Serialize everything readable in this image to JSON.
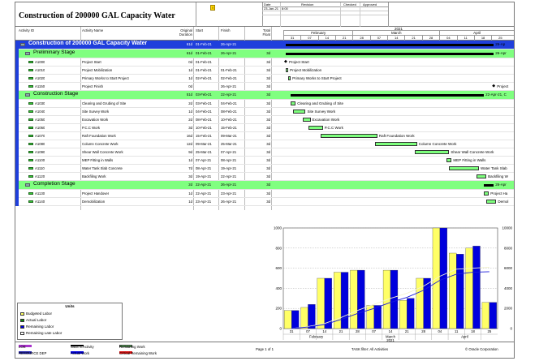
{
  "header": {
    "title": "Construction of 200000 GAL Capacity Water",
    "rev_headers": [
      "Date",
      "Revision",
      "Checked",
      "Approved"
    ],
    "rev_row": [
      "23-Jan-21",
      "8:00"
    ]
  },
  "columns": {
    "activity_id": "Activity ID",
    "activity_name": "Activity Name",
    "orig_duration": "Original Duration",
    "start": "Start",
    "finish": "Finish",
    "total_float": "Total Float"
  },
  "timeline": {
    "year": "2021",
    "months": [
      "February",
      "March",
      "April"
    ],
    "days": [
      "31",
      "07",
      "14",
      "21",
      "28",
      "07",
      "14",
      "21",
      "28",
      "04",
      "11",
      "18",
      "25"
    ]
  },
  "rows": [
    {
      "type": "wbs1",
      "id": "",
      "name": "Construction of 200000 GAL Capacity Water",
      "dur": "61d",
      "start": "01-Feb-21",
      "finish": "26-Apr-21",
      "float": ""
    },
    {
      "type": "wbs2",
      "id": "",
      "name": "Preliminary Stage",
      "dur": "61d",
      "start": "01-Feb-21",
      "finish": "26-Apr-21",
      "float": "3d"
    },
    {
      "type": "task",
      "id": "A1000",
      "name": "Project Start",
      "dur": "0d",
      "start": "01-Feb-21",
      "finish": "",
      "float": "3d"
    },
    {
      "type": "task",
      "id": "A1010",
      "name": "Project Mobilization",
      "dur": "1d",
      "start": "01-Feb-21",
      "finish": "01-Feb-21",
      "float": "3d"
    },
    {
      "type": "task",
      "id": "A1020",
      "name": "Primary Works to Start Project",
      "dur": "1d",
      "start": "02-Feb-21",
      "finish": "02-Feb-21",
      "float": "3d"
    },
    {
      "type": "task",
      "id": "A1150",
      "name": "Project Finish",
      "dur": "0d",
      "start": "",
      "finish": "26-Apr-21",
      "float": "3d"
    },
    {
      "type": "wbs2",
      "id": "",
      "name": "Construction Stage",
      "dur": "51d",
      "start": "03-Feb-21",
      "finish": "22-Apr-21",
      "float": "3d"
    },
    {
      "type": "task",
      "id": "A1030",
      "name": "Clearing and Grubing of Site",
      "dur": "2d",
      "start": "03-Feb-21",
      "finish": "04-Feb-21",
      "float": "3d"
    },
    {
      "type": "task",
      "id": "A1040",
      "name": "Site Survey Work",
      "dur": "1d",
      "start": "04-Feb-21",
      "finish": "08-Feb-21",
      "float": "3d"
    },
    {
      "type": "task",
      "id": "A1050",
      "name": "Excavation Work",
      "dur": "2d",
      "start": "08-Feb-21",
      "finish": "10-Feb-21",
      "float": "3d"
    },
    {
      "type": "task",
      "id": "A1060",
      "name": "P.C.C Work",
      "dur": "3d",
      "start": "10-Feb-21",
      "finish": "15-Feb-21",
      "float": "3d"
    },
    {
      "type": "task",
      "id": "A1070",
      "name": "Raft Foundation Work",
      "dur": "16d",
      "start": "15-Feb-21",
      "finish": "09-Mar-21",
      "float": "3d"
    },
    {
      "type": "task",
      "id": "A1080",
      "name": "Column Concrete Work",
      "dur": "12d",
      "start": "09-Mar-21",
      "finish": "25-Mar-21",
      "float": "3d"
    },
    {
      "type": "task",
      "id": "A1090",
      "name": "Shear Wall Concrete Work",
      "dur": "9d",
      "start": "25-Mar-21",
      "finish": "07-Apr-21",
      "float": "3d"
    },
    {
      "type": "task",
      "id": "A1100",
      "name": "MEP Fitting in Walls",
      "dur": "1d",
      "start": "07-Apr-21",
      "finish": "08-Apr-21",
      "float": "3d"
    },
    {
      "type": "task",
      "id": "A1110",
      "name": "Water Tank Slab Concrete",
      "dur": "7d",
      "start": "08-Apr-21",
      "finish": "19-Apr-21",
      "float": "3d"
    },
    {
      "type": "task",
      "id": "A1120",
      "name": "Backfiling Work",
      "dur": "3d",
      "start": "19-Apr-21",
      "finish": "22-Apr-21",
      "float": "3d"
    },
    {
      "type": "wbs2",
      "id": "",
      "name": "Completion Stage",
      "dur": "2d",
      "start": "22-Apr-21",
      "finish": "26-Apr-21",
      "float": "3d"
    },
    {
      "type": "task",
      "id": "A1130",
      "name": "Project Handover",
      "dur": "1d",
      "start": "22-Apr-21",
      "finish": "23-Apr-21",
      "float": "3d"
    },
    {
      "type": "task",
      "id": "A1140",
      "name": "Demobilization",
      "dur": "1d",
      "start": "23-Apr-21",
      "finish": "26-Apr-21",
      "float": "3d"
    }
  ],
  "gantt_labels": {
    "project_start": "Project Start",
    "mobilization": "Project Mobilization",
    "primary": "Primary Works to Start Project",
    "finish": "Project",
    "clearing": "Clearing and Grubing of Site",
    "survey": "Site Survey Work",
    "excavation": "Excavation Work",
    "pcc": "P.C.C Work",
    "raft": "Raft Foundation Work",
    "column": "Column Concrete Work",
    "shear": "Shear Wall Concrete Work",
    "mep": "MEP Fitting in Walls",
    "slab": "Water Tank Slab",
    "backfill": "Backfiling W",
    "handover": "Project Ha",
    "demob": "Demol",
    "sum1": "26-Ap",
    "sum2": "26-Apr",
    "sum3": "22-Apr-21, C",
    "sum4": "26-Apr"
  },
  "chart_data": {
    "type": "bar",
    "categories": [
      "31",
      "07",
      "14",
      "21",
      "28",
      "07",
      "14",
      "21",
      "28",
      "04",
      "11",
      "18",
      "25"
    ],
    "series": [
      {
        "name": "Budgeted Labor",
        "color": "#ffff66",
        "values": [
          180,
          210,
          500,
          560,
          580,
          230,
          580,
          280,
          500,
          1000,
          750,
          800,
          260
        ]
      },
      {
        "name": "Remaining Labor",
        "color": "#0000dd",
        "values": [
          180,
          240,
          500,
          560,
          580,
          230,
          580,
          300,
          500,
          1000,
          740,
          820,
          260
        ]
      }
    ],
    "left_ticks": [
      "0",
      "200",
      "400",
      "600",
      "800",
      "1000"
    ],
    "right_ticks": [
      "0",
      "2000",
      "4000",
      "6000",
      "8000",
      "10000"
    ],
    "ylim": [
      0,
      1000
    ],
    "months": [
      "February",
      "March",
      "April"
    ],
    "year": "2021",
    "cumulative_budget": [
      0,
      200,
      500,
      1100,
      1800,
      2400,
      3000,
      3500,
      4200,
      5200,
      5900,
      6000,
      6100
    ],
    "cumulative_remaining": [
      0,
      150,
      400,
      900,
      1500,
      2000,
      2600,
      3100,
      3800,
      4800,
      5400,
      5600,
      5650
    ]
  },
  "legend": {
    "title": "Units",
    "items": [
      {
        "label": "Budgeted Labor",
        "color": "#ffff66"
      },
      {
        "label": "Actual Labor",
        "color": "#118811"
      },
      {
        "label": "Remaining Labor",
        "color": "#0000dd"
      },
      {
        "label": "Remaining Late Labor",
        "color": "#ffffff"
      }
    ]
  },
  "footer": {
    "loe": "LOE",
    "resource_dep": "RESOURCE DEP",
    "wbs_activity": "WBS S.Activity",
    "actual_work": "Actual Work",
    "remaining_work": "Remaining Work",
    "critical_remaining": "Critical Remaining Work",
    "page": "Page 1 of 1",
    "task_filter": "TASK filter: All Activities",
    "copyright": "© Oracle Corporation"
  }
}
